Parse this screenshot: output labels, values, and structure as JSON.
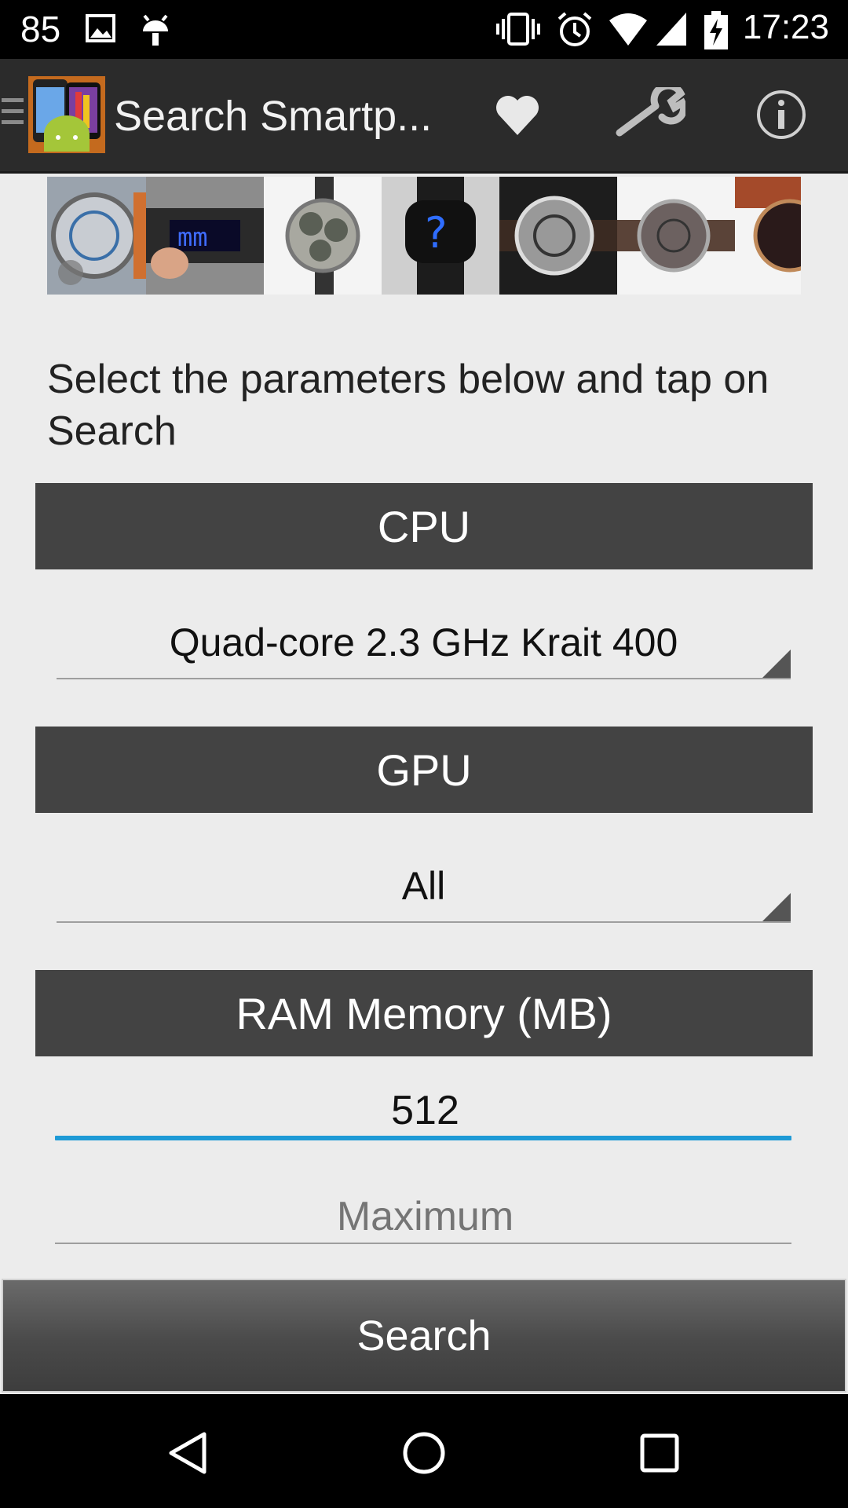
{
  "status_bar": {
    "notification_count": "85",
    "time": "17:23",
    "icons": [
      "gallery-icon",
      "android-debug-icon",
      "vibrate-icon",
      "alarm-icon",
      "wifi-icon",
      "signal-icon",
      "battery-charging-icon"
    ]
  },
  "action_bar": {
    "title": "Search Smartp...",
    "icons": [
      "drawer-icon",
      "app-logo",
      "favorites-heart-icon",
      "settings-wrench-icon",
      "info-icon"
    ]
  },
  "banner": {
    "images": [
      "skeleton-watch",
      "led-bracelet-watch",
      "multi-dial-watch",
      "blue-led-watch",
      "mechanical-watch",
      "brown-leather-watch",
      "red-strap-watch"
    ]
  },
  "intro_text": "Select the parameters below and tap on Search",
  "cpu": {
    "header": "CPU",
    "selected": "Quad-core 2.3 GHz Krait 400"
  },
  "gpu": {
    "header": "GPU",
    "selected": "All"
  },
  "ram": {
    "header": "RAM Memory (MB)",
    "min_value": "512",
    "max_placeholder": "Maximum"
  },
  "search_label": "Search",
  "colors": {
    "header_bg": "#434343",
    "action_bar_bg": "#2b2b2b",
    "focus_accent": "#1e9ad6"
  }
}
